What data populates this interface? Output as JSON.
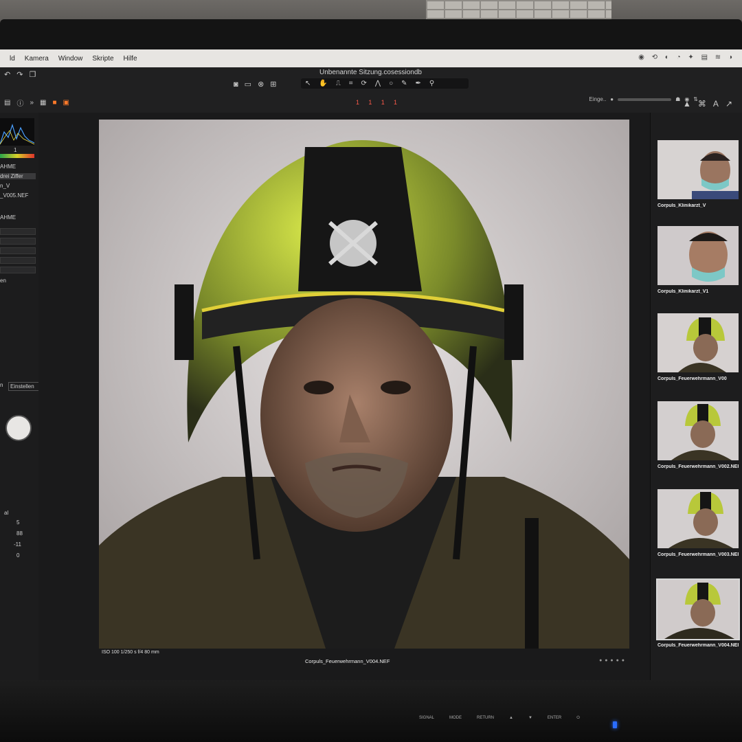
{
  "menubar": {
    "items": [
      "ld",
      "Kamera",
      "Window",
      "Skripte",
      "Hilfe"
    ]
  },
  "toolbar": {
    "session_title": "Unbenannte Sitzung.cosessiondb",
    "view_tools": [
      "camera-icon",
      "battery-icon",
      "circle-x-icon",
      "grid-icon"
    ],
    "cursor_tools": [
      "pointer-icon",
      "pan-icon",
      "stamp-icon",
      "crop-icon",
      "rotate-icon",
      "keystone-icon",
      "circle-icon",
      "brush-icon",
      "pen-icon",
      "eyedropper-icon"
    ],
    "page_marks": [
      "1",
      "1",
      "1",
      "1"
    ],
    "eingabe_label": "Einge..",
    "accent": "#ff7a2a"
  },
  "left_panel": {
    "items": [
      "1",
      "AHME",
      "drei Ziffer",
      "n_V",
      "_V005.NEF",
      "AHME",
      "en",
      "n",
      "Einstellen",
      "5",
      "88",
      "-11",
      "0",
      "al"
    ]
  },
  "viewer": {
    "exif": "ISO 100    1/250 s    f/4    80 mm",
    "filename": "Corpuls_Feuerwehrmann_V004.NEF"
  },
  "browser": {
    "thumbnails": [
      {
        "label": "Corpuls_Klinikarzt_V",
        "subject": "doctor"
      },
      {
        "label": "Corpuls_Klinikarzt_V1",
        "subject": "doctor"
      },
      {
        "label": "Corpuls_Feuerwehrmann_V00",
        "subject": "firefighter"
      },
      {
        "label": "Corpuls_Feuerwehrmann_V002.NEF",
        "subject": "firefighter"
      },
      {
        "label": "Corpuls_Feuerwehrmann_V003.NEF",
        "subject": "firefighter"
      },
      {
        "label": "Corpuls_Feuerwehrmann_V004.NEF",
        "subject": "firefighter",
        "selected": true
      }
    ]
  },
  "monitor_buttons": [
    "SIGNAL",
    "MODE",
    "RETURN",
    "▲",
    "▼",
    "ENTER",
    "⏻"
  ]
}
